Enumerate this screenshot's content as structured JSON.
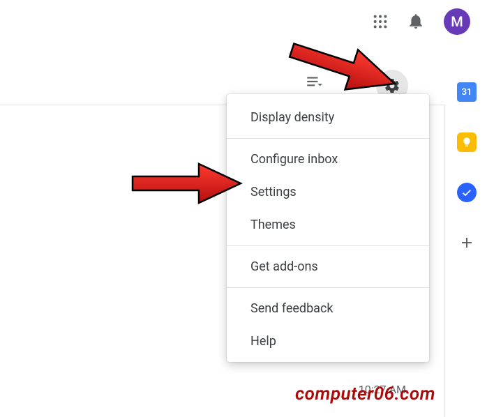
{
  "topbar": {
    "avatar_initial": "M"
  },
  "gear_menu": {
    "items": [
      "Display density",
      "Configure inbox",
      "Settings",
      "Themes",
      "Get add-ons",
      "Send feedback",
      "Help"
    ]
  },
  "side_panel": {
    "calendar_day": "31"
  },
  "inbox": {
    "timestamp": "10:27 AM"
  },
  "watermark": "computer06.com"
}
